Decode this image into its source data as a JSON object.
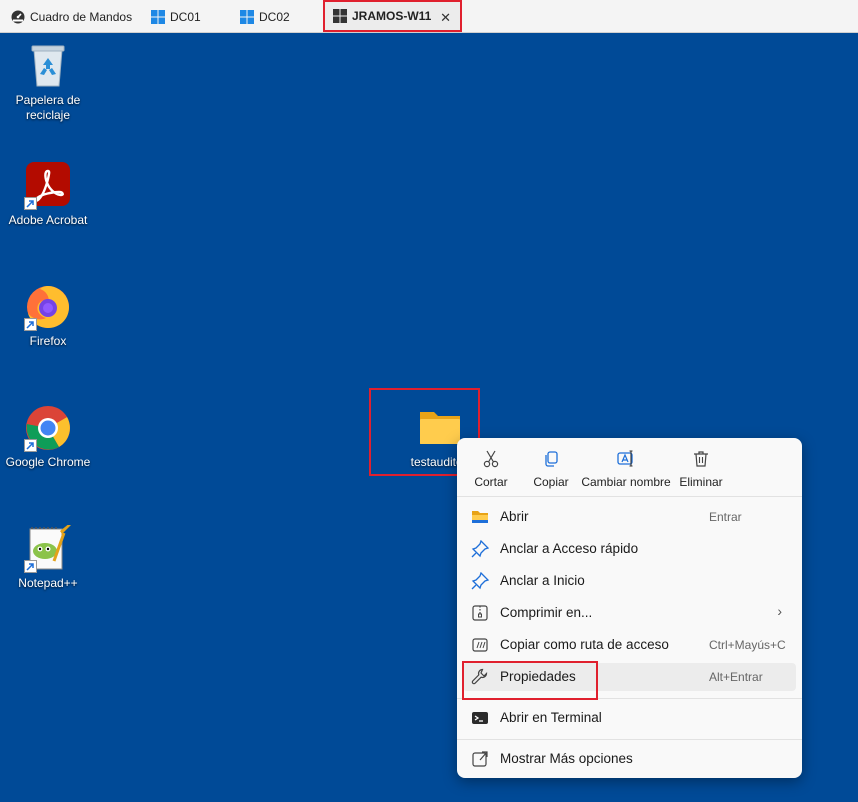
{
  "tabs": {
    "dashboard": {
      "label": "Cuadro de Mandos",
      "icon": "dashboard-icon"
    },
    "dc01": {
      "label": "DC01",
      "icon": "windows-icon"
    },
    "dc02": {
      "label": "DC02",
      "icon": "windows-icon"
    },
    "active": {
      "label": "JRAMOS-W11",
      "icon": "windows-icon",
      "close": "✕"
    }
  },
  "desktop": {
    "recycle_bin": "Papelera de reciclaje",
    "acrobat": "Adobe Acrobat",
    "firefox": "Firefox",
    "chrome": "Google Chrome",
    "notepadpp": "Notepad++",
    "folder": "testauditori"
  },
  "context_menu": {
    "quick_actions": {
      "cut": "Cortar",
      "copy": "Copiar",
      "rename": "Cambiar nombre",
      "delete": "Eliminar"
    },
    "items": {
      "open": {
        "label": "Abrir",
        "shortcut": "Entrar"
      },
      "pin_quick": {
        "label": "Anclar a Acceso rápido"
      },
      "pin_start": {
        "label": "Anclar a Inicio"
      },
      "compress": {
        "label": "Comprimir en...",
        "chevron": "›"
      },
      "copy_path": {
        "label": "Copiar como ruta de acceso",
        "shortcut": "Ctrl+Mayús+C"
      },
      "properties": {
        "label": "Propiedades",
        "shortcut": "Alt+Entrar"
      },
      "terminal": {
        "label": "Abrir en Terminal"
      },
      "more": {
        "label": "Mostrar Más opciones"
      }
    }
  },
  "colors": {
    "desktop_bg": "#004a97",
    "highlight": "#e0202e",
    "accent": "#0067c0"
  }
}
